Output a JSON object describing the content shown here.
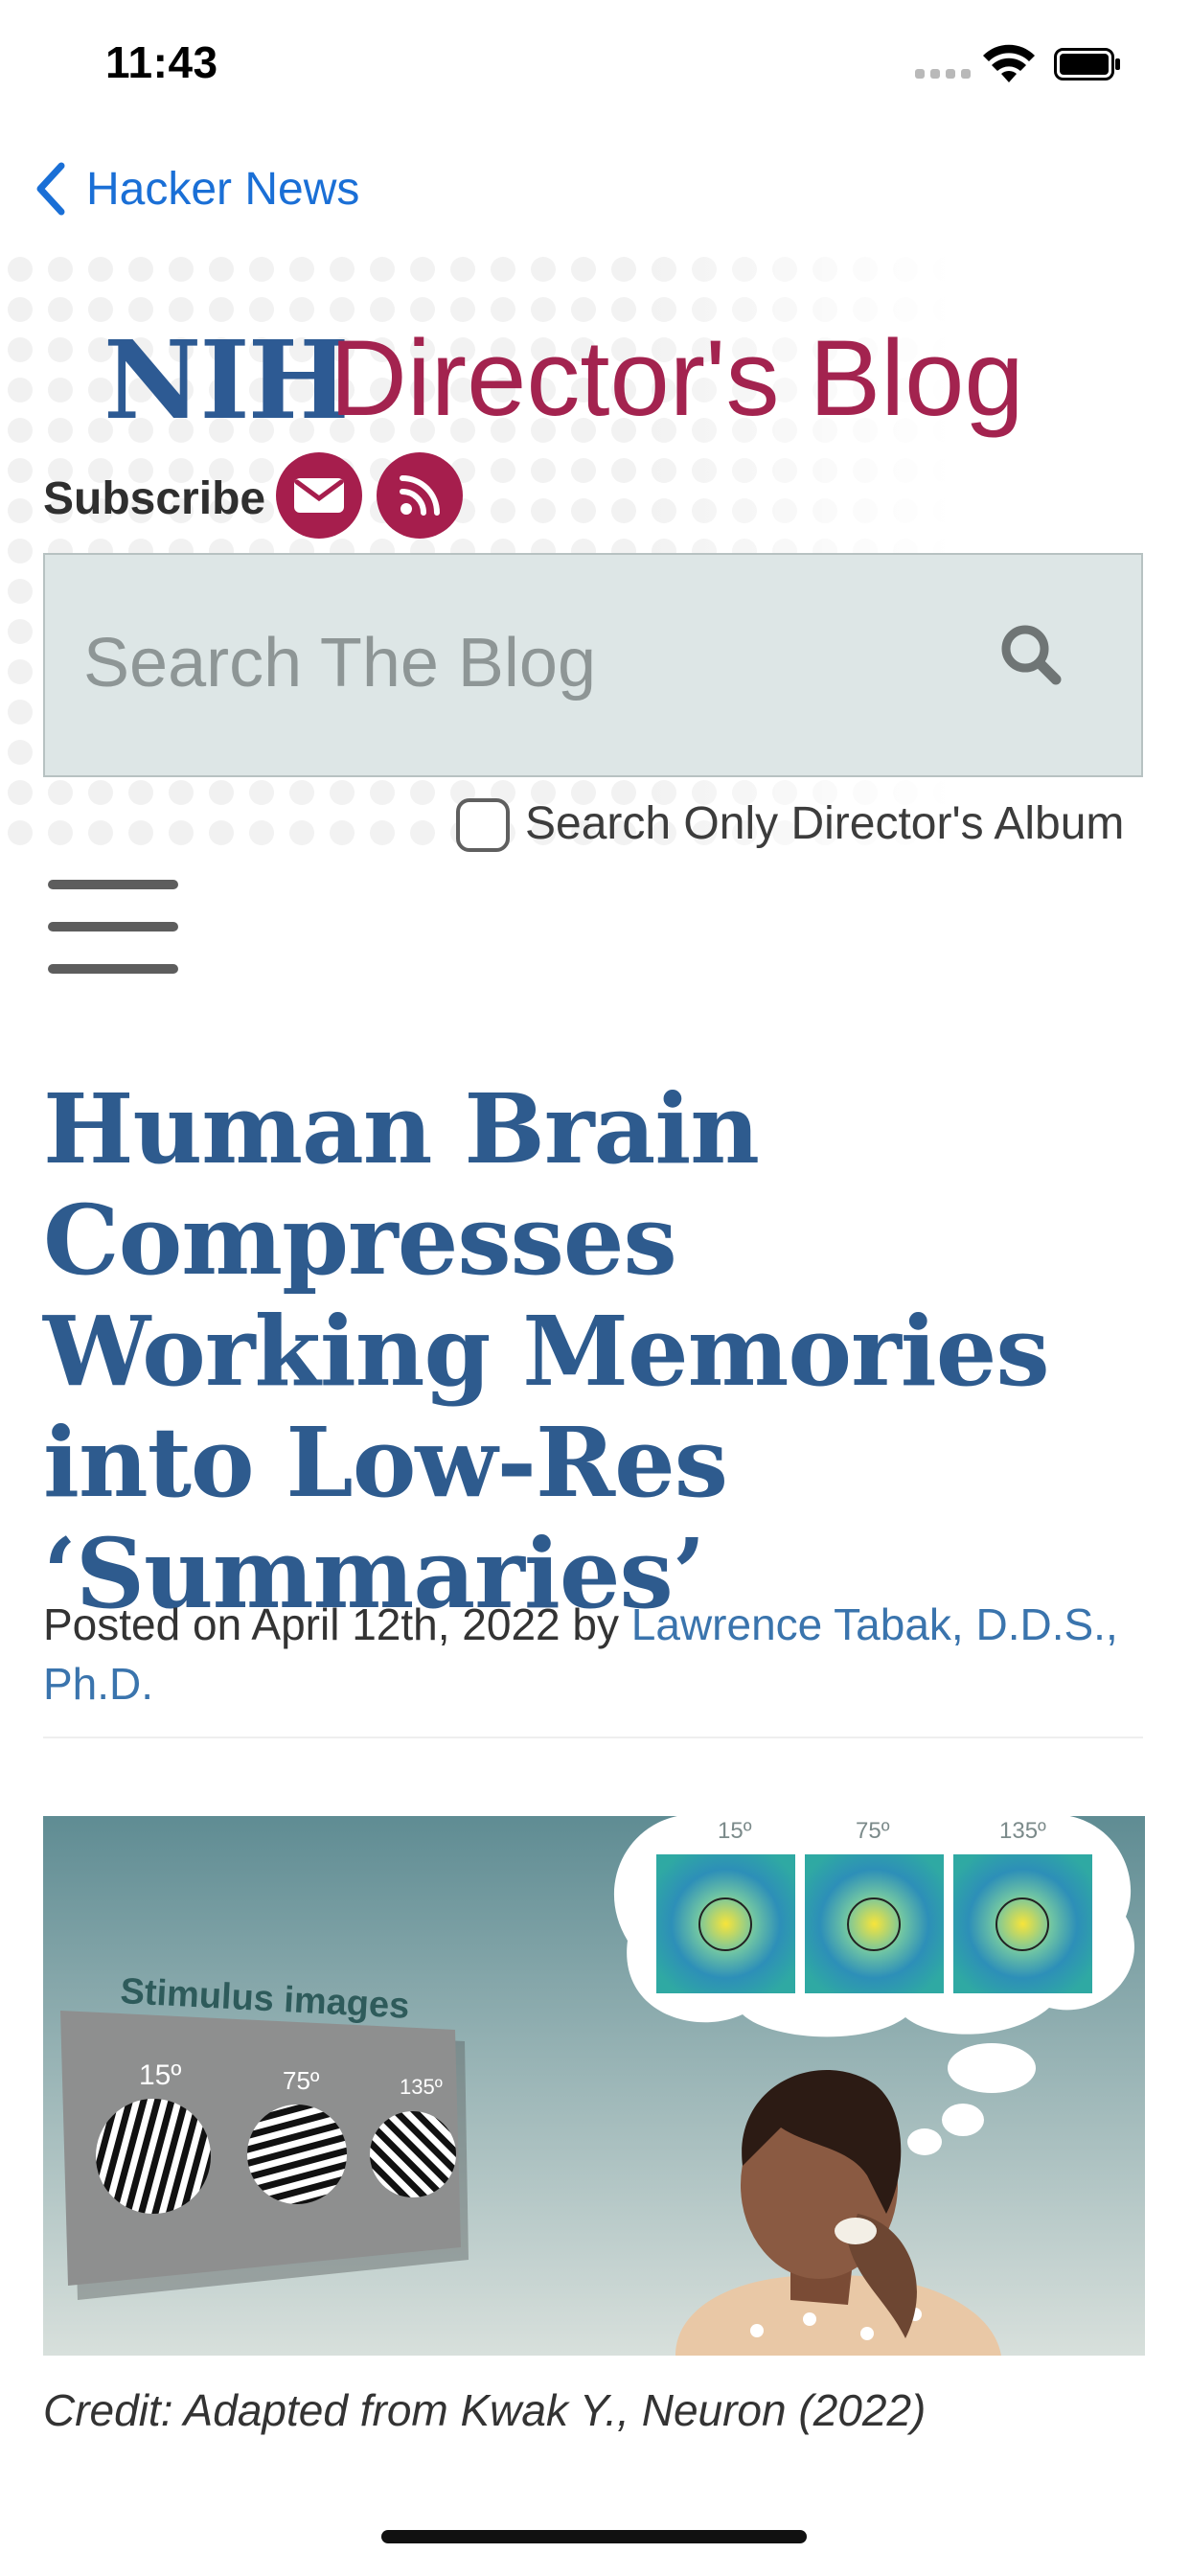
{
  "status_bar": {
    "time": "11:43"
  },
  "nav": {
    "back_label": "Hacker News"
  },
  "blog": {
    "logo_nih": "NIH",
    "logo_rest": "Director's Blog",
    "subscribe_label": "Subscribe",
    "search_placeholder": "Search The Blog",
    "album_filter_label": "Search Only Director's Album"
  },
  "article": {
    "title": "Human Brain Compresses Working Memories into Low-Res ‘Summaries’",
    "posted_prefix": "Posted on April 12th, 2022 by ",
    "author": "Lawrence Tabak, D.D.S., Ph.D.",
    "figure": {
      "stimulus_label": "Stimulus images",
      "stimulus_angles": [
        "15º",
        "75º",
        "135º"
      ],
      "thought_angles": [
        "15º",
        "75º",
        "135º"
      ]
    },
    "credit": "Credit: Adapted from Kwak Y., Neuron (2022)"
  },
  "colors": {
    "nih_blue": "#2d5a93",
    "blog_red": "#a3234f",
    "link_blue": "#1a6fd6",
    "search_bg": "#dde6e6"
  }
}
